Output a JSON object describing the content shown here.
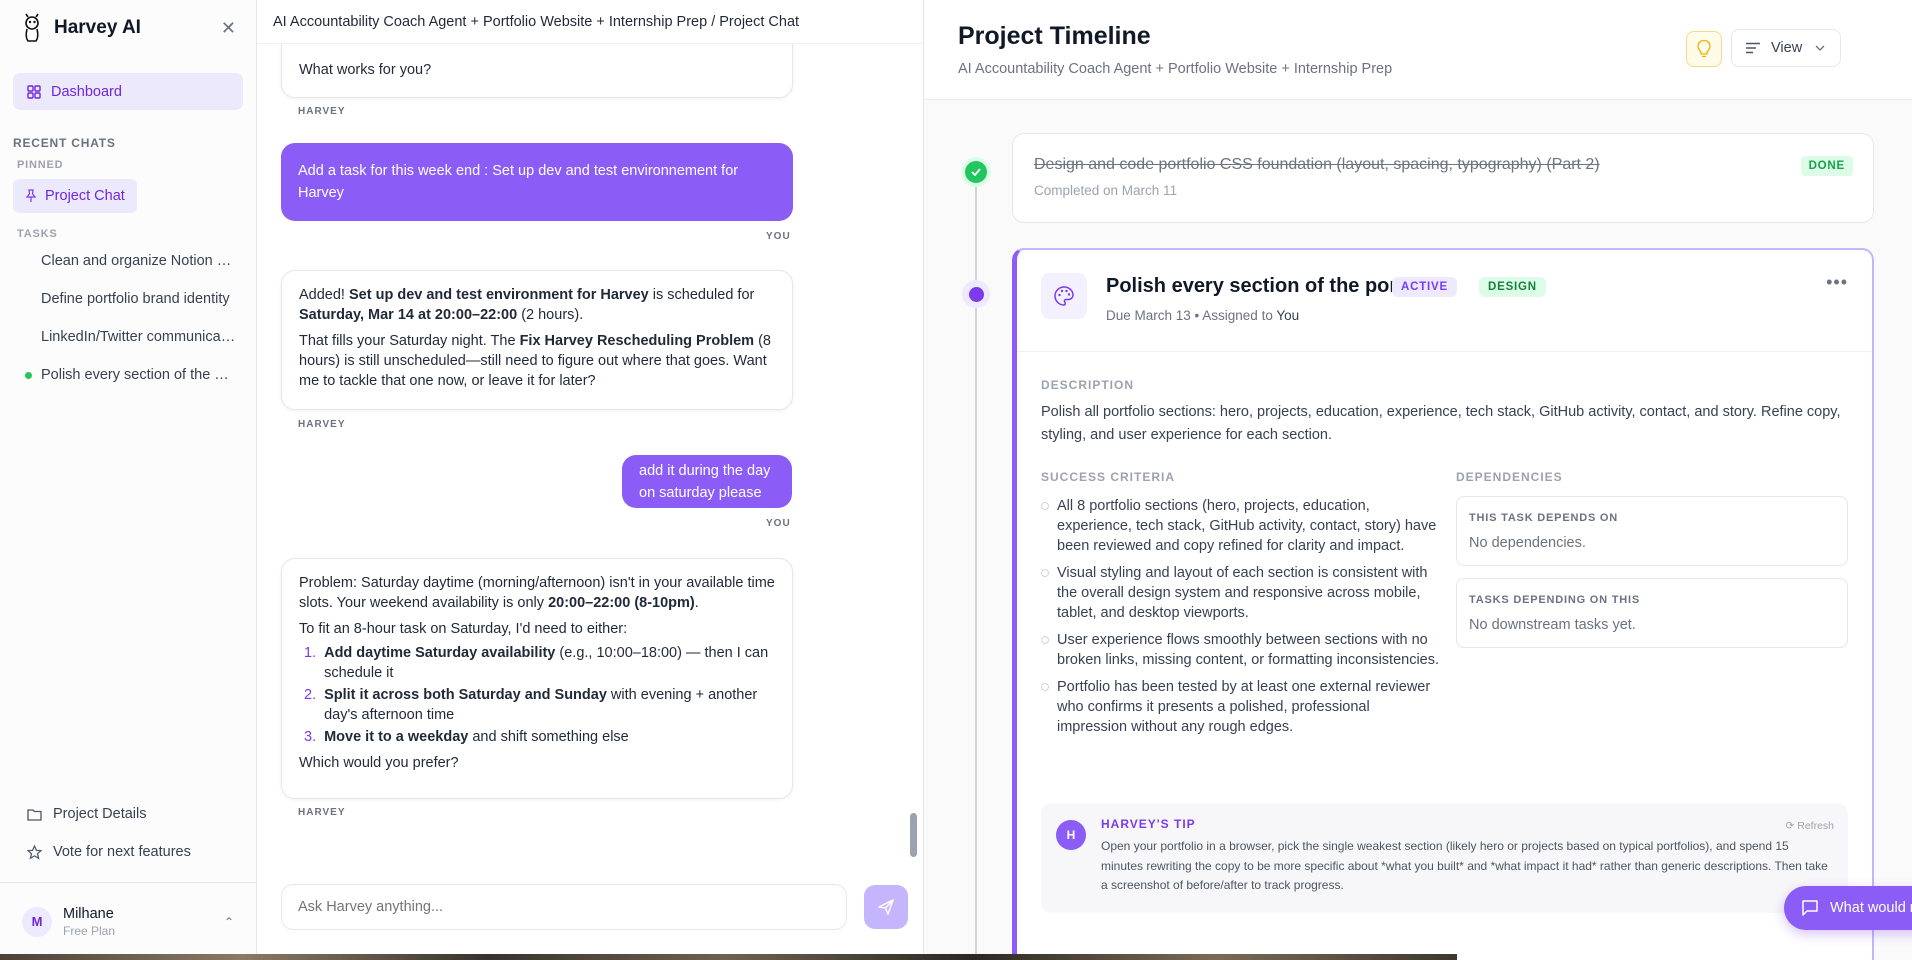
{
  "app": {
    "title": "Harvey AI"
  },
  "sidebar": {
    "dashboard": "Dashboard",
    "recent_chats": "RECENT CHATS",
    "pinned_label": "PINNED",
    "pinned_chat": "Project Chat",
    "tasks_label": "TASKS",
    "tasks": [
      "Clean and organize Notion workspace",
      "Define portfolio brand identity",
      "LinkedIn/Twitter communication plan",
      "Polish every section of the portfolio"
    ],
    "project_details": "Project Details",
    "vote": "Vote for next features",
    "user": {
      "initial": "M",
      "name": "Milhane",
      "plan": "Free Plan"
    }
  },
  "chat": {
    "breadcrumb": "AI Accountability Coach Agent + Portfolio Website + Internship Prep / Project Chat",
    "msg0": "What works for you?",
    "user1": "Add a task for this week end : Set up dev and test environnement for Harvey",
    "ai2": {
      "p1a": "Added! ",
      "p1b": "Set up dev and test environment for Harvey",
      "p1c": " is scheduled for ",
      "p1d": "Saturday, Mar 14 at 20:00–22:00",
      "p1e": " (2 hours).",
      "p2a": "That fills your Saturday night. The ",
      "p2b": "Fix Harvey Rescheduling Problem",
      "p2c": " (8 hours) is still unscheduled—still need to figure out where that goes. Want me to tackle that one now, or leave it for later?"
    },
    "user3": "add it during the day on saturday please",
    "ai4": {
      "p1a": "Problem: Saturday daytime (morning/afternoon) isn't in your available time slots. Your weekend availability is only ",
      "p1b": "20:00–22:00 (8-10pm)",
      "p1c": ".",
      "p2": "To fit an 8-hour task on Saturday, I'd need to either:",
      "o1b": "Add daytime Saturday availability",
      "o1c": " (e.g., 10:00–18:00) — then I can schedule it",
      "o2b": "Split it across both Saturday and Sunday",
      "o2c": " with evening + another day's afternoon time",
      "o3b": "Move it to a weekday",
      "o3c": " and shift something else",
      "p3": "Which would you prefer?"
    },
    "harvey": "HARVEY",
    "you": "YOU",
    "input_placeholder": "Ask Harvey anything..."
  },
  "timeline": {
    "title": "Project Timeline",
    "subtitle": "AI Accountability Coach Agent + Portfolio Website + Internship Prep",
    "view": "View",
    "done_task": {
      "title": "Design and code portfolio CSS foundation (layout, spacing, typography) (Part 2)",
      "completed": "Completed on March 11",
      "badge": "DONE"
    },
    "active_task": {
      "title": "Polish every section of the portfolio",
      "badge_status": "ACTIVE",
      "badge_tag": "DESIGN",
      "due": "Due March 13",
      "assigned_prefix": "Assigned to",
      "assignee": "You",
      "description_label": "DESCRIPTION",
      "description": "Polish all portfolio sections: hero, projects, education, experience, tech stack, GitHub activity, contact, and story. Refine copy, styling, and user experience for each section.",
      "criteria_label": "SUCCESS CRITERIA",
      "criteria": [
        "All 8 portfolio sections (hero, projects, education, experience, tech stack, GitHub activity, contact, story) have been reviewed and copy refined for clarity and impact.",
        "Visual styling and layout of each section is consistent with the overall design system and responsive across mobile, tablet, and desktop viewports.",
        "User experience flows smoothly between sections with no broken links, missing content, or formatting inconsistencies.",
        "Portfolio has been tested by at least one external reviewer who confirms it presents a polished, professional impression without any rough edges."
      ],
      "dependencies_label": "DEPENDENCIES",
      "depends_on_label": "THIS TASK DEPENDS ON",
      "depends_on": "No dependencies.",
      "dependents_label": "TASKS DEPENDING ON THIS",
      "dependents": "No downstream tasks yet.",
      "tip_label": "HARVEY'S TIP",
      "tip_refresh": "Refresh",
      "tip_avatar": "H",
      "tip": "Open your portfolio in a browser, pick the single weakest section (likely hero or projects based on typical portfolios), and spend 15 minutes rewriting the copy to be more specific about *what you built* and *what impact it had* rather than generic descriptions. Then take a screenshot of before/after to track progress."
    },
    "feedback": "What would make Harvey better?"
  },
  "colors": {
    "accent": "#8b5cf6",
    "accent_dark": "#7c3aed",
    "success": "#22c55e"
  }
}
